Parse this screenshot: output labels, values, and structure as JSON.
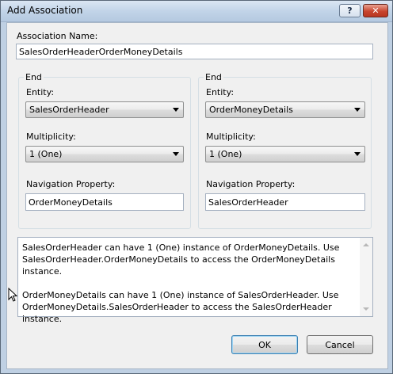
{
  "window": {
    "title": "Add Association",
    "help_glyph": "?",
    "close_glyph": "✕"
  },
  "association": {
    "label": "Association Name:",
    "value": "SalesOrderHeaderOrderMoneyDetails"
  },
  "ends": [
    {
      "title": "End",
      "entity_label": "Entity:",
      "entity_value": "SalesOrderHeader",
      "multiplicity_label": "Multiplicity:",
      "multiplicity_value": "1 (One)",
      "nav_label": "Navigation Property:",
      "nav_value": "OrderMoneyDetails"
    },
    {
      "title": "End",
      "entity_label": "Entity:",
      "entity_value": "OrderMoneyDetails",
      "multiplicity_label": "Multiplicity:",
      "multiplicity_value": "1 (One)",
      "nav_label": "Navigation Property:",
      "nav_value": "SalesOrderHeader"
    }
  ],
  "description": {
    "line1": "SalesOrderHeader can have 1 (One) instance of OrderMoneyDetails. Use SalesOrderHeader.OrderMoneyDetails to access the OrderMoneyDetails instance.",
    "line2": "OrderMoneyDetails can have 1 (One) instance of SalesOrderHeader. Use OrderMoneyDetails.SalesOrderHeader to access the SalesOrderHeader instance."
  },
  "buttons": {
    "ok": "OK",
    "cancel": "Cancel"
  }
}
